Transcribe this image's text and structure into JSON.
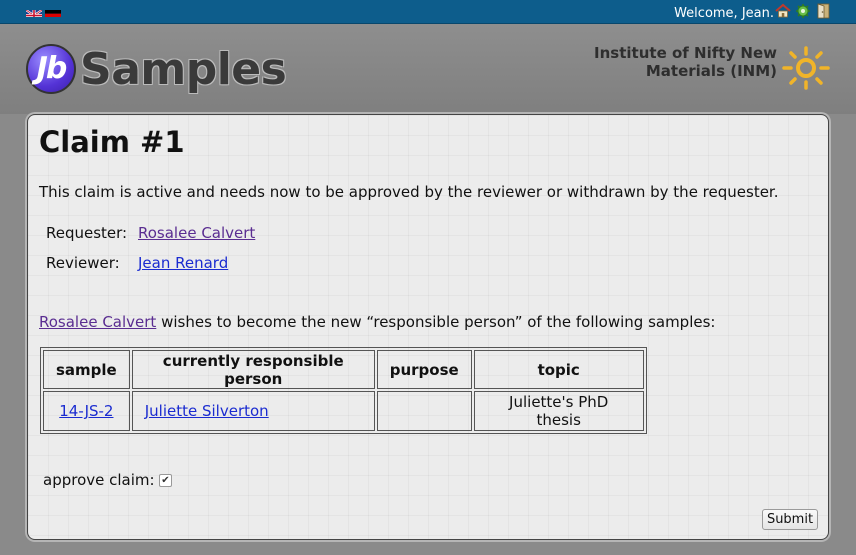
{
  "topbar": {
    "welcome": "Welcome, Jean.",
    "icons": [
      "uk-flag-icon",
      "german-flag-icon",
      "home-icon",
      "settings-icon",
      "logout-icon"
    ]
  },
  "header": {
    "logo_mark": "Jb",
    "logo_text": "Samples",
    "institute": "Institute of Nifty New Materials (INM)"
  },
  "claim": {
    "title": "Claim #1",
    "status": "This claim is active and needs now to be approved by the reviewer or withdrawn by the requester.",
    "requester_label": "Requester:",
    "requester": "Rosalee Calvert",
    "reviewer_label": "Reviewer:",
    "reviewer": "Jean Renard",
    "wish_person": "Rosalee Calvert",
    "wish_text": " wishes to become the new “responsible person” of the following samples:"
  },
  "table": {
    "headers": [
      "sample",
      "currently responsible person",
      "purpose",
      "topic"
    ],
    "rows": [
      {
        "sample": "14-JS-2",
        "person": "Juliette Silverton",
        "purpose": "",
        "topic": "Juliette's PhD thesis"
      }
    ]
  },
  "form": {
    "approve_label": "approve claim:",
    "approve_checked": true,
    "submit_label": "Submit"
  },
  "colors": {
    "topbar": "#0d5d8c",
    "visited_link": "#5a2d91",
    "link": "#1a2bd0",
    "background": "#8a8a8a",
    "panel": "#ececec"
  }
}
